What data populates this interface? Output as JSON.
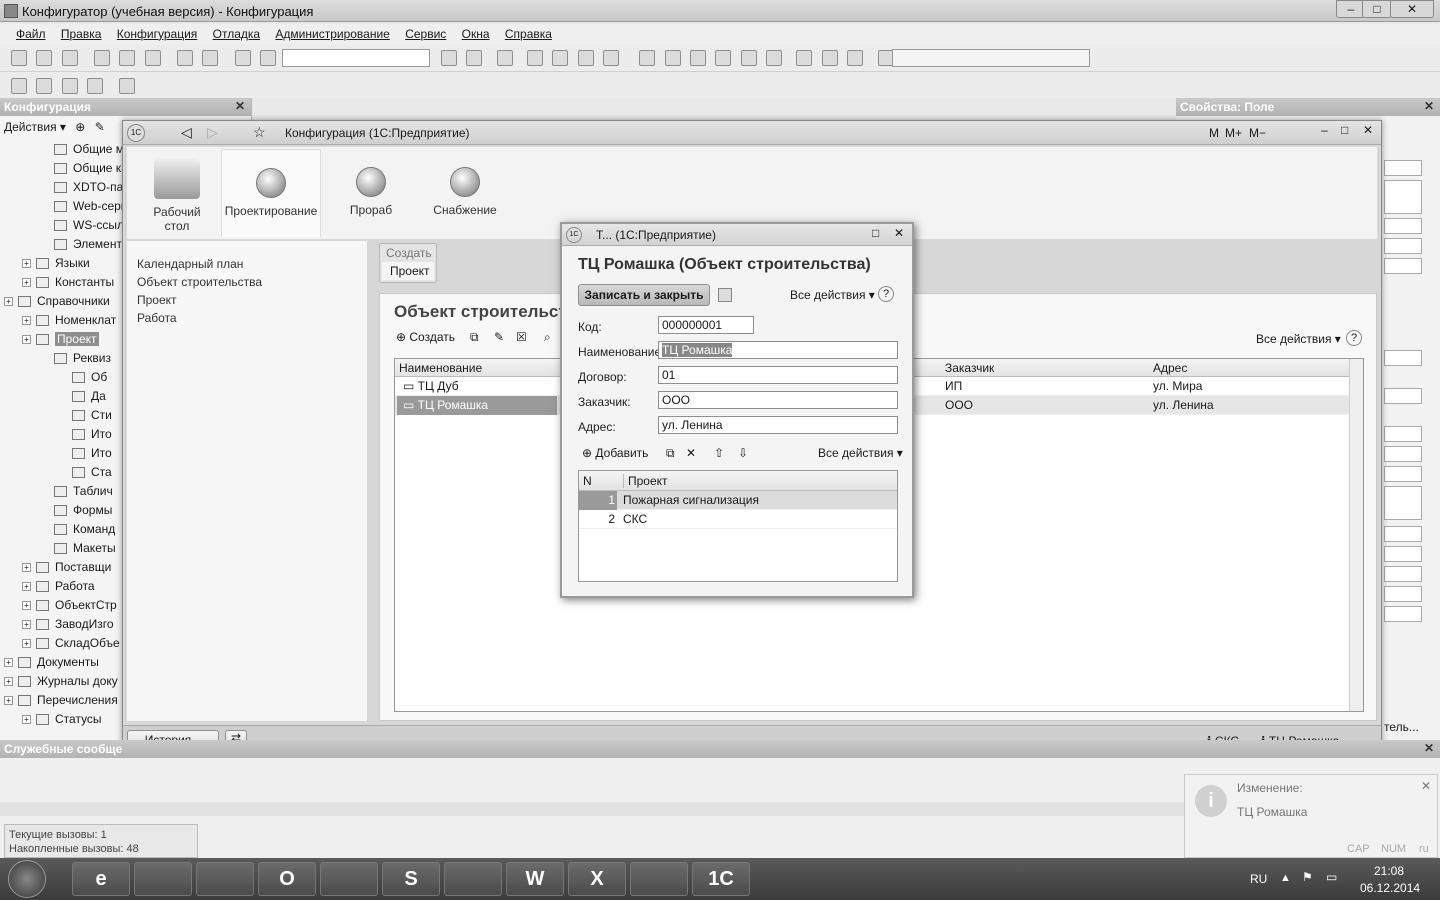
{
  "window": {
    "title": "Конфигуратор (учебная версия) - Конфигурация"
  },
  "menu": [
    "Файл",
    "Правка",
    "Конфигурация",
    "Отладка",
    "Администрирование",
    "Сервис",
    "Окна",
    "Справка"
  ],
  "left_panel": {
    "title": "Конфигурация",
    "actions_label": "Действия",
    "tree": [
      {
        "label": "Общие мак",
        "indent": 2
      },
      {
        "label": "Общие кар",
        "indent": 2
      },
      {
        "label": "XDTO-паке",
        "indent": 2
      },
      {
        "label": "Web-серви",
        "indent": 2
      },
      {
        "label": "WS-ссылк",
        "indent": 2
      },
      {
        "label": "Элементы",
        "indent": 2
      },
      {
        "label": "Языки",
        "indent": 1
      },
      {
        "label": "Константы",
        "indent": 1
      },
      {
        "label": "Справочники",
        "indent": 0
      },
      {
        "label": "Номенклат",
        "indent": 1
      },
      {
        "label": "Проект",
        "indent": 1
      },
      {
        "label": "Реквиз",
        "indent": 2
      },
      {
        "label": "Об",
        "indent": 3
      },
      {
        "label": "Да",
        "indent": 3
      },
      {
        "label": "Сти",
        "indent": 3
      },
      {
        "label": "Ито",
        "indent": 3
      },
      {
        "label": "Ито",
        "indent": 3
      },
      {
        "label": "Ста",
        "indent": 3
      },
      {
        "label": "Таблич",
        "indent": 2
      },
      {
        "label": "Формы",
        "indent": 2
      },
      {
        "label": "Команд",
        "indent": 2
      },
      {
        "label": "Макеты",
        "indent": 2
      },
      {
        "label": "Поставщи",
        "indent": 1
      },
      {
        "label": "Работа",
        "indent": 1
      },
      {
        "label": "ОбъектСтр",
        "indent": 1
      },
      {
        "label": "ЗаводИзго",
        "indent": 1
      },
      {
        "label": "СкладОбъе",
        "indent": 1
      },
      {
        "label": "Документы",
        "indent": 0
      },
      {
        "label": "Журналы доку",
        "indent": 0
      },
      {
        "label": "Перечисления",
        "indent": 0
      },
      {
        "label": "Статусы",
        "indent": 1
      }
    ]
  },
  "right_panel": {
    "title": "Свойства: Поле",
    "partial_label": "тель..."
  },
  "enterprise": {
    "title": "Конфигурация (1С:Предприятие)",
    "toolbar_m": [
      "M",
      "M+",
      "M−"
    ],
    "sections": [
      {
        "label": "Рабочий стол"
      },
      {
        "label": "Проектирование"
      },
      {
        "label": "Прораб"
      },
      {
        "label": "Снабжение"
      }
    ],
    "nav": [
      "Календарный план",
      "Объект строительства",
      "Проект",
      "Работа"
    ],
    "create_panel": {
      "title": "Создать",
      "item": "Проект"
    },
    "list": {
      "title": "Объект строительства",
      "create_label": "Создать",
      "all_actions": "Все действия",
      "columns": [
        "Наименование",
        "Заказчик",
        "Адрес"
      ],
      "rows": [
        {
          "name": "ТЦ Дуб",
          "customer": "ИП",
          "address": "ул. Мира"
        },
        {
          "name": "ТЦ Ромашка",
          "customer": "ООО",
          "address": "ул. Ленина"
        }
      ]
    },
    "history_label": "История...",
    "status_items": [
      "СКС",
      "ТЦ Ромашка"
    ]
  },
  "dialog": {
    "title": "Т... (1С:Предприятие)",
    "heading": "ТЦ Ромашка (Объект строительства)",
    "save_close": "Записать и закрыть",
    "all_actions": "Все действия",
    "fields": {
      "code_label": "Код:",
      "code": "000000001",
      "name_label": "Наименование:",
      "name": "ТЦ Ромашка",
      "contract_label": "Договор:",
      "contract": "01",
      "customer_label": "Заказчик:",
      "customer": "ООО",
      "address_label": "Адрес:",
      "address": "ул. Ленина"
    },
    "add_label": "Добавить",
    "table": {
      "columns": [
        "N",
        "Проект"
      ],
      "rows": [
        {
          "n": "1",
          "project": "Пожарная сигнализация"
        },
        {
          "n": "2",
          "project": "СКС"
        }
      ]
    }
  },
  "bottom": {
    "messages_title": "Служебные сообще",
    "calls_current": "Текущие вызовы: 1",
    "calls_accum": "Накопленные вызовы: 48",
    "notification_title": "Изменение:",
    "notification_text": "ТЦ Ромашка",
    "indicators": [
      "CAP",
      "NUM",
      "ru"
    ]
  },
  "taskbar": {
    "lang": "RU",
    "time": "21:08",
    "date": "06.12.2014",
    "apps": [
      "e",
      "",
      "",
      "O",
      "",
      "S",
      "",
      "W",
      "X",
      "",
      "1С"
    ]
  }
}
